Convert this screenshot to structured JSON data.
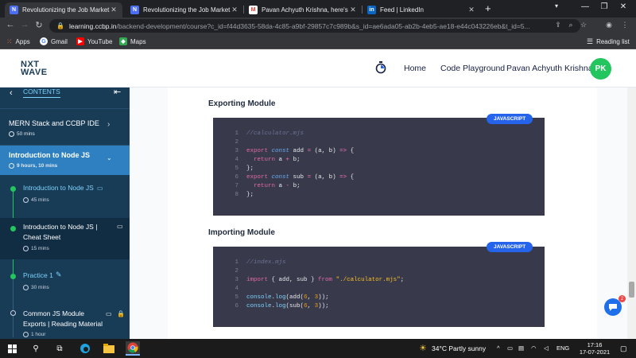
{
  "browser": {
    "tabs": [
      {
        "title": "Revolutionizing the Job Market |",
        "favicon": "N",
        "color": "#4c6ef5",
        "active": true
      },
      {
        "title": "Revolutionizing the Job Market |",
        "favicon": "N",
        "color": "#4c6ef5",
        "active": false
      },
      {
        "title": "Pavan Achyuth Krishna, here's yo",
        "favicon": "M",
        "color": "#ea4335",
        "active": false
      },
      {
        "title": "Feed | LinkedIn",
        "favicon": "in",
        "color": "#0a66c2",
        "active": false
      }
    ],
    "new_tab": "+",
    "url_domain": "learning.ccbp.in",
    "url_path": "/backend-development/course?c_id=f44d3635-58da-4c85-a9bf-29857c7c989b&s_id=ae6ada05-ab2b-4eb5-ae18-e44c043226eb&t_id=5...",
    "bookmarks": [
      {
        "label": "Apps",
        "icon": "apps-icon"
      },
      {
        "label": "Gmail",
        "icon": "google-icon"
      },
      {
        "label": "YouTube",
        "icon": "youtube-icon"
      },
      {
        "label": "Maps",
        "icon": "maps-icon"
      }
    ],
    "reading_list": "Reading list"
  },
  "site": {
    "logo_line1": "NXT",
    "logo_line2": "WAVE",
    "nav": {
      "home": "Home",
      "playground": "Code Playground",
      "user": "Pavan Achyuth Krishna"
    },
    "avatar": "PK",
    "colors": {
      "brand": "#183b56",
      "accent": "#22c55e",
      "link": "#2563eb"
    }
  },
  "sidebar": {
    "contents_label": "CONTENTS",
    "courses": [
      {
        "title": "MERN Stack and CCBP IDE",
        "duration": "50 mins",
        "active": false
      },
      {
        "title": "Introduction to Node JS",
        "duration": "9 hours, 10 mins",
        "active": true
      }
    ],
    "items": [
      {
        "label": "Introduction to Node JS",
        "duration": "45 mins",
        "status": "done"
      },
      {
        "label": "Introduction to Node JS | Cheat Sheet",
        "duration": "15 mins",
        "status": "done"
      },
      {
        "label": "Practice 1",
        "duration": "30 mins",
        "status": "done"
      },
      {
        "label": "Common JS Module Exports | Reading Material",
        "duration": "1 hour",
        "status": "locked"
      }
    ]
  },
  "content": {
    "sections": [
      {
        "heading": "Exporting Module",
        "language": "JAVASCRIPT",
        "lines": [
          [
            {
              "t": "//calculator.mjs",
              "c": "cm"
            }
          ],
          [],
          [
            {
              "t": "export",
              "c": "kw"
            },
            {
              "t": " "
            },
            {
              "t": "const",
              "c": "it"
            },
            {
              "t": " add "
            },
            {
              "t": "=",
              "c": "op"
            },
            {
              "t": " (a, b) "
            },
            {
              "t": "=>",
              "c": "op"
            },
            {
              "t": " {"
            }
          ],
          [
            {
              "t": "  "
            },
            {
              "t": "return",
              "c": "kw"
            },
            {
              "t": " a "
            },
            {
              "t": "+",
              "c": "op"
            },
            {
              "t": " b;"
            }
          ],
          [
            {
              "t": "};"
            }
          ],
          [
            {
              "t": "export",
              "c": "kw"
            },
            {
              "t": " "
            },
            {
              "t": "const",
              "c": "it"
            },
            {
              "t": " sub "
            },
            {
              "t": "=",
              "c": "op"
            },
            {
              "t": " (a, b) "
            },
            {
              "t": "=>",
              "c": "op"
            },
            {
              "t": " {"
            }
          ],
          [
            {
              "t": "  "
            },
            {
              "t": "return",
              "c": "kw"
            },
            {
              "t": " a "
            },
            {
              "t": "-",
              "c": "op"
            },
            {
              "t": " b;"
            }
          ],
          [
            {
              "t": "};"
            }
          ]
        ]
      },
      {
        "heading": "Importing Module",
        "language": "JAVASCRIPT",
        "lines": [
          [
            {
              "t": "//index.mjs",
              "c": "cm"
            }
          ],
          [],
          [
            {
              "t": "import",
              "c": "kw"
            },
            {
              "t": " { add, sub } "
            },
            {
              "t": "from",
              "c": "kw"
            },
            {
              "t": " "
            },
            {
              "t": "\"./calculator.mjs\"",
              "c": "st"
            },
            {
              "t": ";"
            }
          ],
          [],
          [
            {
              "t": "console",
              "c": "fn"
            },
            {
              "t": "."
            },
            {
              "t": "log",
              "c": "fn"
            },
            {
              "t": "(add("
            },
            {
              "t": "6",
              "c": "nm"
            },
            {
              "t": ", "
            },
            {
              "t": "3",
              "c": "nm"
            },
            {
              "t": "));"
            }
          ],
          [
            {
              "t": "console",
              "c": "fn"
            },
            {
              "t": "."
            },
            {
              "t": "log",
              "c": "fn"
            },
            {
              "t": "(sub("
            },
            {
              "t": "6",
              "c": "nm"
            },
            {
              "t": ", "
            },
            {
              "t": "3",
              "c": "nm"
            },
            {
              "t": "));"
            }
          ]
        ]
      }
    ]
  },
  "chat": {
    "unread": "2"
  },
  "taskbar": {
    "weather": "34°C  Partly sunny",
    "lang": "ENG",
    "time": "17:16",
    "date": "17-07-2021"
  }
}
